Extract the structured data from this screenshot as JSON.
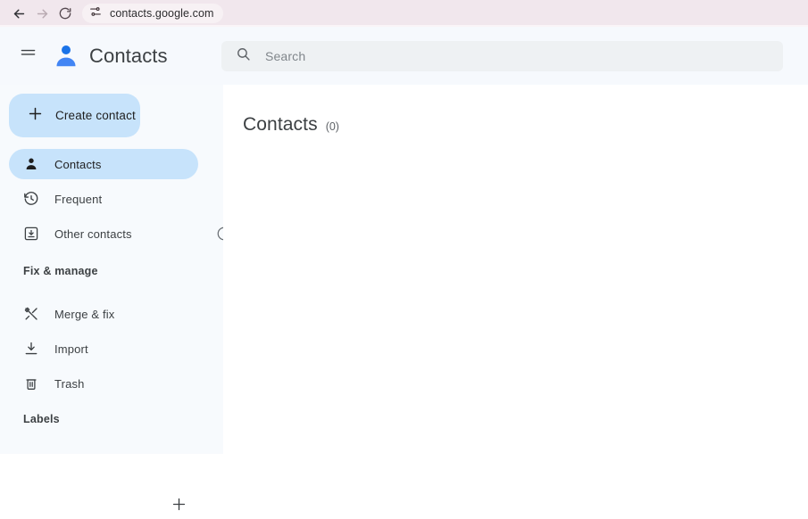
{
  "browser": {
    "back_icon": "arrow-left-icon",
    "forward_icon": "arrow-right-icon",
    "reload_icon": "reload-icon",
    "site_settings_icon": "page-settings-sliders-icon",
    "url": "contacts.google.com",
    "bar_color": "#f1e7ed"
  },
  "header": {
    "menu_icon": "hamburger-menu-icon",
    "logo_icon": "contacts-person-logo-icon",
    "title": "Contacts",
    "logo_color": "#1a73e8"
  },
  "search": {
    "icon": "search-icon",
    "placeholder": "Search",
    "value": "",
    "background": "#eef1f3"
  },
  "sidebar": {
    "create_button": {
      "icon": "plus-icon",
      "label": "Create contact",
      "background": "#c7e3fb"
    },
    "nav_items": [
      {
        "icon": "person-icon",
        "label": "Contacts",
        "active": true
      },
      {
        "icon": "history-clock-icon",
        "label": "Frequent",
        "active": false
      },
      {
        "icon": "inbox-download-icon",
        "label": "Other contacts",
        "active": false,
        "trailing_icon": "info-circle-icon"
      }
    ],
    "fix_manage": {
      "heading": "Fix & manage",
      "items": [
        {
          "icon": "merge-tools-icon",
          "label": "Merge & fix"
        },
        {
          "icon": "import-download-icon",
          "label": "Import"
        },
        {
          "icon": "trash-bin-icon",
          "label": "Trash"
        }
      ]
    },
    "labels": {
      "heading": "Labels",
      "add_icon": "plus-icon"
    },
    "background": "#f7fafd",
    "active_pill_color": "#c7e3fb"
  },
  "main": {
    "title": "Contacts",
    "count": "(0)"
  }
}
